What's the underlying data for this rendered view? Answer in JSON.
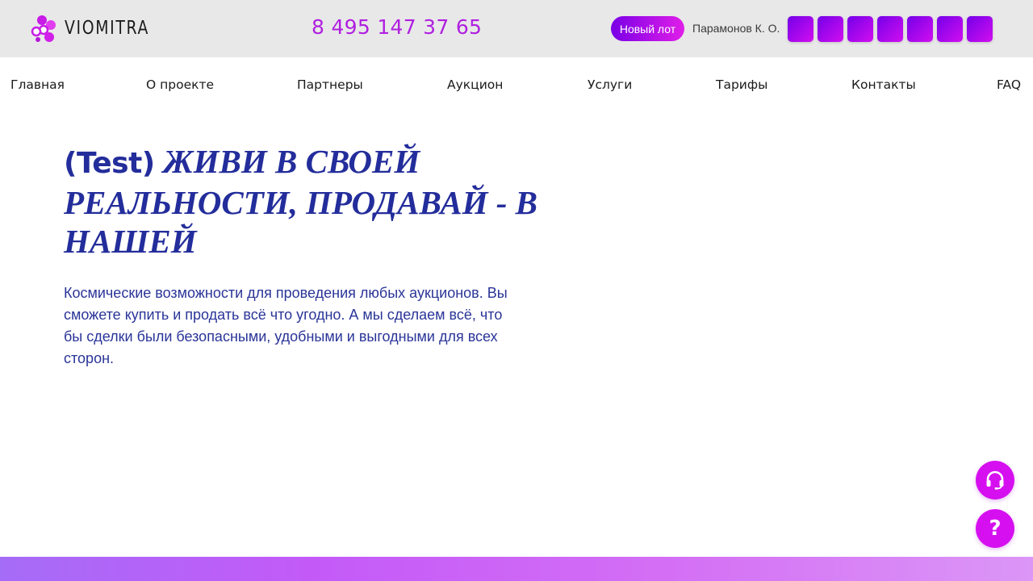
{
  "header": {
    "logo_text": "VIOMITRA",
    "phone": "8 495 147 37 65",
    "new_lot_label": "Новый лот",
    "user_name": "Парамонов К. О."
  },
  "nav": {
    "items": [
      "Главная",
      "О проекте",
      "Партнеры",
      "Аукцион",
      "Услуги",
      "Тарифы",
      "Контакты",
      "FAQ"
    ]
  },
  "hero": {
    "title_prefix": "(Test)",
    "title_main": "ЖИВИ В СВОЕЙ РЕАЛЬНОСТИ, ПРОДАВАЙ - В НАШЕЙ",
    "description": "Космические возможности для проведения любых аукционов. Вы сможете купить и продать всё что угодно. А мы сделаем всё, что бы сделки были безопасными, удобными и выгодными для всех сторон."
  },
  "fabs": {
    "support_icon": "headset-icon",
    "help_label": "?"
  },
  "colors": {
    "brand_purple": "#b020e0",
    "title_blue": "#232d9b",
    "fab_magenta": "#d60ff0",
    "header_bg": "#e8e8e8"
  }
}
